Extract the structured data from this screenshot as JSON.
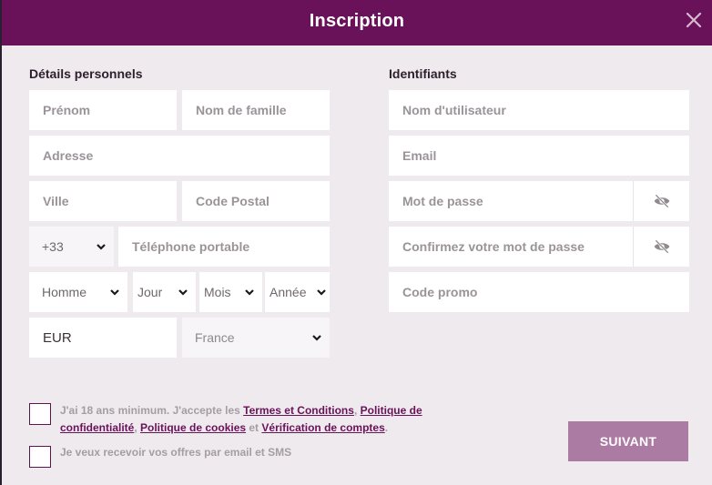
{
  "header": {
    "title": "Inscription",
    "close_icon": "close-icon"
  },
  "personal": {
    "title": "Détails personnels",
    "first_name_placeholder": "Prénom",
    "last_name_placeholder": "Nom de famille",
    "address_placeholder": "Adresse",
    "city_placeholder": "Ville",
    "postal_placeholder": "Code Postal",
    "phone_prefix": "+33",
    "phone_placeholder": "Téléphone portable",
    "gender": "Homme",
    "day": "Jour",
    "month": "Mois",
    "year": "Année",
    "currency": "EUR",
    "country": "France"
  },
  "credentials": {
    "title": "Identifiants",
    "username_placeholder": "Nom d'utilisateur",
    "email_placeholder": "Email",
    "password_placeholder": "Mot de passe",
    "confirm_password_placeholder": "Confirmez votre mot de passe",
    "promo_placeholder": "Code promo",
    "eye_icon": "eye-slash-icon"
  },
  "consent": {
    "terms_prefix": "J'ai 18 ans minimum. J'accepte les ",
    "terms_link": "Termes et Conditions",
    "sep1": ", ",
    "privacy_link": "Politique de confidentialité",
    "sep2": ", ",
    "cookies_link": "Politique de cookies",
    "sep3": " et ",
    "verification_link": "Vérification de comptes",
    "end": ".",
    "marketing_label": "Je veux recevoir vos offres par email et SMS"
  },
  "actions": {
    "next_label": "SUIVANT"
  },
  "colors": {
    "brand": "#6a1259",
    "background": "#efeaee",
    "button": "#ac7ba3"
  }
}
